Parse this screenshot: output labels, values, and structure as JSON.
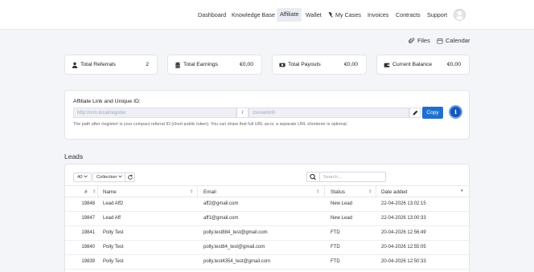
{
  "nav": {
    "items": [
      {
        "label": "Dashboard",
        "active": false
      },
      {
        "label": "Knowledge Base",
        "active": false
      },
      {
        "label": "Affiliate",
        "active": true
      },
      {
        "label": "Wallet",
        "active": false
      },
      {
        "label": "My Cases",
        "active": false,
        "icon": "hammer-icon"
      },
      {
        "label": "Invoices",
        "active": false
      },
      {
        "label": "Contracts",
        "active": false
      },
      {
        "label": "Support",
        "active": false
      }
    ],
    "avatar_icon": "user-avatar-icon"
  },
  "top_links": {
    "files": "Files",
    "calendar": "Calendar"
  },
  "stats": [
    {
      "label": "Total Referrals",
      "value": "2",
      "icon": "user-icon"
    },
    {
      "label": "Total Earnings",
      "value": "€0,00",
      "icon": "coins-icon"
    },
    {
      "label": "Total Payouts",
      "value": "€0,00",
      "icon": "money-bill-icon"
    },
    {
      "label": "Current Balance",
      "value": "€0,00",
      "icon": "wallet-icon"
    }
  ],
  "affiliate": {
    "title": "Affiliate Link and Unique ID:",
    "base_url": "http://crm.local/register",
    "separator": "/",
    "token": "zsxswmnh",
    "copy_label": "Copy",
    "info_glyph": "i",
    "note": "The path after /register/ is your compact referral ID (short public token). You can share that full URL as-is; a separate URL shortener is optional."
  },
  "leads": {
    "title": "Leads",
    "page_size": "40",
    "collection_label": "Collection",
    "search_placeholder": "Search...",
    "columns": [
      "#",
      "Name",
      "Email",
      "Status",
      "Date added"
    ],
    "sorted_column": "Date added",
    "sort_direction": "desc",
    "rows": [
      {
        "id": "19848",
        "name": "Lead Aff2",
        "email": "aff2@gmail.com",
        "status": "New Lead",
        "date": "22-04-2026 13:02:15"
      },
      {
        "id": "19847",
        "name": "Lead Aff",
        "email": "aff1@gmail.com",
        "status": "New Lead",
        "date": "22-04-2026 13:00:33"
      },
      {
        "id": "19841",
        "name": "Polly Test",
        "email": "polly.test884_test@gmail.com",
        "status": "FTD",
        "date": "20-04-2026 12:56:49"
      },
      {
        "id": "19840",
        "name": "Polly Test",
        "email": "polly.test84_test@gmail.com",
        "status": "FTD",
        "date": "20-04-2026 12:55:05"
      },
      {
        "id": "19839",
        "name": "Polly Test",
        "email": "polly.test4354_test@gmail.com",
        "status": "FTD",
        "date": "20-04-2026 12:50:33"
      }
    ]
  },
  "colors": {
    "primary": "#1f6fd1",
    "info": "#1a56b8",
    "background": "#f4f5f8",
    "card": "#ffffff"
  }
}
